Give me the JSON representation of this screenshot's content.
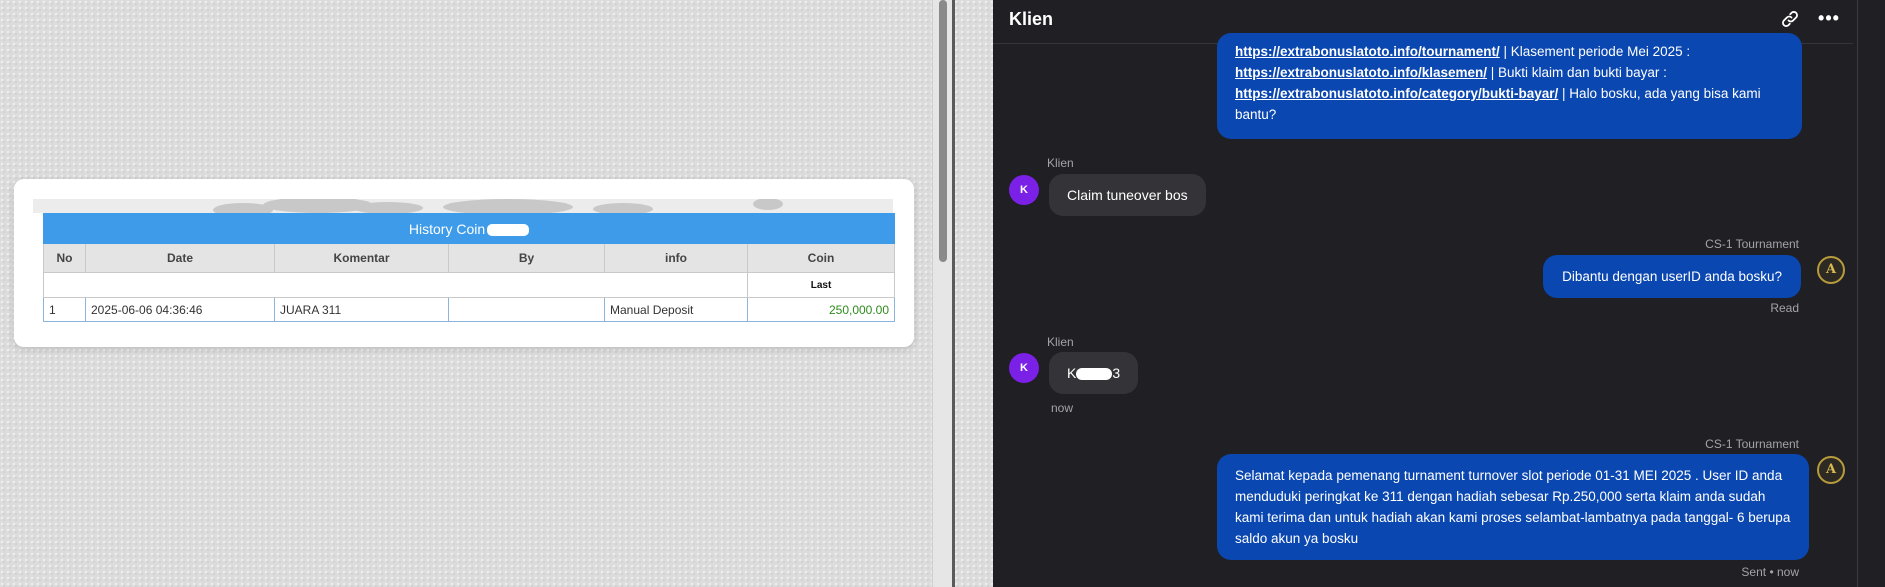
{
  "history": {
    "title": "History Coin",
    "columns": [
      "No",
      "Date",
      "Komentar",
      "By",
      "info",
      "Coin"
    ],
    "sub_label": "Last",
    "rows": [
      {
        "no": "1",
        "date": "2025-06-06 04:36:46",
        "komentar": "JUARA 311",
        "by": "",
        "info": "Manual Deposit",
        "coin": "250,000.00"
      }
    ]
  },
  "chat": {
    "title": "Klien",
    "messages": {
      "m1": {
        "link1": "https://extrabonuslatoto.info/tournament/",
        "text1": " | Klasement periode Mei 2025 :",
        "link2": "https://extrabonuslatoto.info/klasemen/",
        "text2": " | Bukti klaim dan bukti bayar :",
        "link3": "https://extrabonuslatoto.info/category/bukti-bayar/",
        "text3": " | Halo bosku, ada yang bisa kami bantu?"
      },
      "m2": {
        "sender": "Klien",
        "avatar": "K",
        "text": "Claim tuneover bos"
      },
      "m3": {
        "sender": "CS-1 Tournament",
        "avatar": "A",
        "text": "Dibantu dengan userID anda bosku?",
        "status": "Read"
      },
      "m4": {
        "sender": "Klien",
        "avatar": "K",
        "text_start": "K",
        "text_end": "3",
        "time": "now"
      },
      "m5": {
        "sender": "CS-1 Tournament",
        "avatar": "A",
        "text": "Selamat kepada pemenang turnament turnover slot periode 01-31 MEI 2025 . User ID anda menduduki peringkat ke 311 dengan hadiah sebesar Rp.250,000 serta klaim anda sudah kami terima dan untuk hadiah akan kami proses selambat-lambatnya pada tanggal- 6 berupa saldo akun ya bosku",
        "status": "Sent • now"
      }
    }
  },
  "icons": {
    "link": "link-icon",
    "more": "more-icon"
  },
  "colors": {
    "table_header": "#3d9be9",
    "bubble_out": "#0a47b0",
    "bubble_in": "#333338",
    "avatar_client": "#7b20e6",
    "coin_value": "#2e8b1e"
  }
}
